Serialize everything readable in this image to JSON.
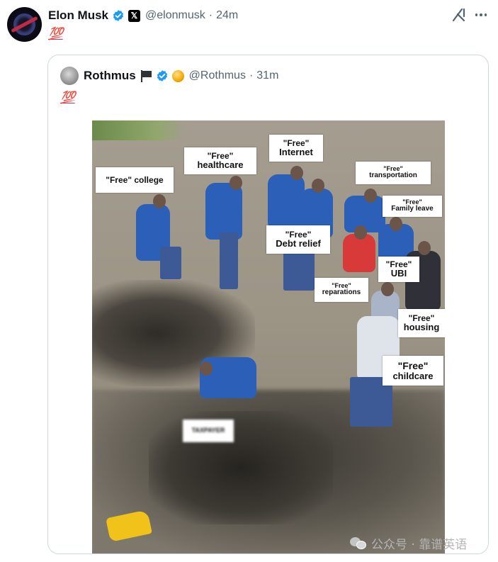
{
  "tweet": {
    "author_name": "Elon Musk",
    "handle": "@elonmusk",
    "separator": "·",
    "time": "24m",
    "text": "💯"
  },
  "quoted_tweet": {
    "author_name": "Rothmus",
    "handle": "@Rothmus",
    "separator": "·",
    "time": "31m",
    "text": "💯"
  },
  "image_signs": {
    "college": {
      "line1": "\"Free\" college",
      "line2": ""
    },
    "healthcare": {
      "line1": "\"Free\"",
      "line2": "healthcare"
    },
    "internet": {
      "line1": "\"Free\"",
      "line2": "Internet"
    },
    "transportation": {
      "line1": "\"Free\"",
      "line2": "transportation"
    },
    "family_leave": {
      "line1": "\"Free\"",
      "line2": "Family leave"
    },
    "debt_relief": {
      "line1": "\"Free\"",
      "line2": "Debt relief"
    },
    "ubi": {
      "line1": "\"Free\"",
      "line2": "UBI"
    },
    "reparations": {
      "line1": "\"Free\"",
      "line2": "reparations"
    },
    "housing": {
      "line1": "\"Free\"",
      "line2": "housing"
    },
    "childcare": {
      "line1": "\"Free\"",
      "line2": "childcare"
    },
    "taxpayer": {
      "line1": "TAXPAYER"
    }
  },
  "watermark": {
    "text": "公众号 · 靠谱英语"
  },
  "icons": {
    "verified": "verified-badge-icon",
    "x_affiliation": "x-logo-icon",
    "grok": "grok-icon",
    "more": "more-icon",
    "flag": "black-flag-icon",
    "coin": "gold-coin-icon"
  },
  "colors": {
    "verified_blue": "#1d9bf0",
    "secondary_text": "#536471",
    "border": "#cfd9de",
    "hundred_red": "#e0245e"
  }
}
